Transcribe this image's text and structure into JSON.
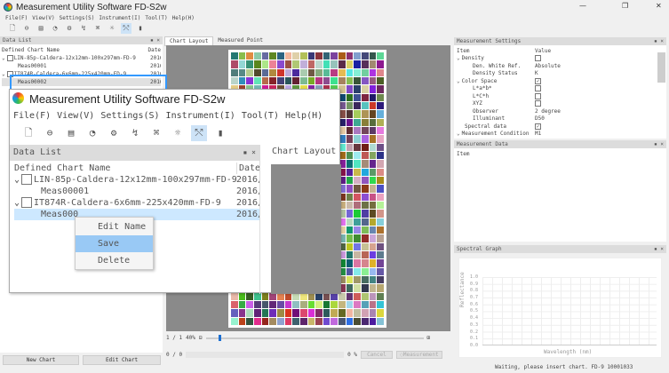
{
  "app": {
    "title": "Measurement Utility Software FD-S2w",
    "win_buttons": [
      "—",
      "❐",
      "✕"
    ]
  },
  "menu": [
    "File(F)",
    "View(V)",
    "Settings(S)",
    "Instrument(I)",
    "Tool(T)",
    "Help(H)"
  ],
  "toolbar": [
    {
      "icon": "new-icon",
      "glyph": "🗋"
    },
    {
      "icon": "open-icon",
      "glyph": "⊖"
    },
    {
      "icon": "save-icon",
      "glyph": "▤"
    },
    {
      "icon": "instrument-icon",
      "glyph": "◔"
    },
    {
      "icon": "calibrate-icon",
      "glyph": "⚙"
    },
    {
      "icon": "measure-icon",
      "glyph": "↯"
    },
    {
      "icon": "network-icon",
      "glyph": "⌘"
    },
    {
      "icon": "light-icon",
      "glyph": "☼"
    },
    {
      "icon": "chart-icon",
      "glyph": "⤲"
    },
    {
      "icon": "gradient-icon",
      "glyph": "▮"
    }
  ],
  "data_list": {
    "title": "Data List",
    "col_name": "Defined Chart Name",
    "col_date": "Date",
    "rows": [
      {
        "name": "LIN-85p-Caldera-12x12mm-100x297mm-FD-9",
        "date": "2016/",
        "level": 0
      },
      {
        "name": "Meas00001",
        "date": "2016/",
        "level": 1
      },
      {
        "name": "IT874R-Caldera-6x6mm-225x420mm-FD-9",
        "date": "2016/",
        "level": 0
      },
      {
        "name": "Meas00002",
        "date": "2016/",
        "level": 1
      }
    ],
    "new_chart": "New Chart",
    "edit_chart": "Edit Chart"
  },
  "tabs": [
    "Chart Layout",
    "Measured Point"
  ],
  "zoom": {
    "page": "1 / 1",
    "percent": "40%",
    "slider_value": 0.06
  },
  "progress": {
    "count": "0 / 0",
    "percent": "0 %",
    "value": 0,
    "cancel": "Cancel",
    "measurement": "Measurement"
  },
  "settings": {
    "title": "Measurement Settings",
    "col_item": "Item",
    "col_value": "Value",
    "rows": [
      {
        "item": "Density",
        "value": "",
        "cb": "off",
        "level": 0,
        "exp": true
      },
      {
        "item": "Den. White Ref.",
        "value": "Absolute",
        "level": 2
      },
      {
        "item": "Density Status",
        "value": "K",
        "level": 2
      },
      {
        "item": "Color Space",
        "value": "",
        "cb": "on",
        "level": 0,
        "exp": true
      },
      {
        "item": "L*a*b*",
        "value": "",
        "cb": "off",
        "level": 2
      },
      {
        "item": "L*C*h",
        "value": "",
        "cb": "off",
        "level": 2
      },
      {
        "item": "XYZ",
        "value": "",
        "cb": "off",
        "level": 2
      },
      {
        "item": "Observer",
        "value": "2 degree",
        "level": 2
      },
      {
        "item": "Illuminant",
        "value": "D50",
        "level": 2
      },
      {
        "item": "Spectral data",
        "value": "",
        "cb": "on",
        "level": 1
      },
      {
        "item": "Measurement Condition",
        "value": "M1",
        "level": 0,
        "exp": true
      }
    ]
  },
  "mdata": {
    "title": "Measurement Data",
    "col_item": "Item"
  },
  "graph": {
    "title": "Spectral Graph",
    "ylabel": "Reflectance",
    "xlabel": "Wavelength (nm)",
    "yticks": [
      "1.0",
      "0.9",
      "0.8",
      "0.7",
      "0.6",
      "0.5",
      "0.4",
      "0.3",
      "0.2",
      "0.1",
      "0.0"
    ]
  },
  "status": "Waiting, please insert chart. FD-9 10001033",
  "overlay": {
    "title": "Measurement Utility Software FD-S2w",
    "tab": "Chart Layout",
    "selected_partial": "Meas000"
  },
  "context_menu": [
    "Edit Name",
    "Save",
    "Delete"
  ],
  "colors": {
    "accent": "#3399ff",
    "selection": "#cde8ff",
    "menu_hover": "#99c9f5"
  }
}
